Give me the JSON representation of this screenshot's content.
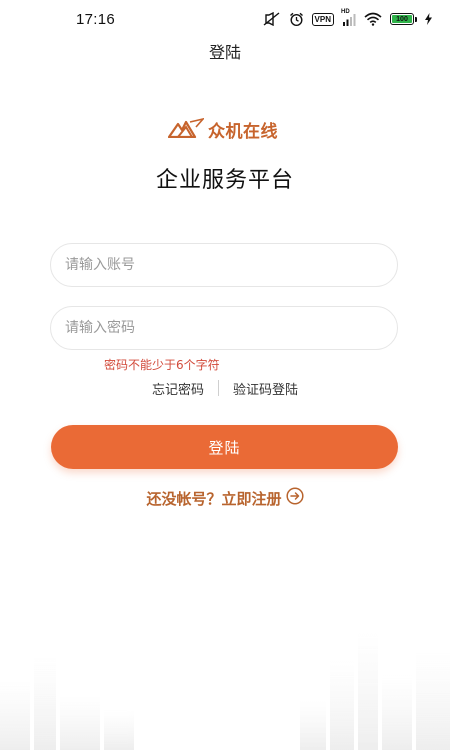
{
  "status_bar": {
    "time": "17:16",
    "vpn_label": "VPN",
    "network_label": "HD",
    "battery_level": "100",
    "colors": {
      "battery": "#2fb34a"
    }
  },
  "header": {
    "title": "登陆"
  },
  "brand": {
    "logo_text": "众机在线",
    "platform_title": "企业服务平台",
    "logo_color": "#c7642d"
  },
  "form": {
    "account_placeholder": "请输入账号",
    "password_placeholder": "请输入密码",
    "password_error": "密码不能少于6个字符",
    "forgot_password_label": "忘记密码",
    "sms_login_label": "验证码登陆",
    "login_button_label": "登陆",
    "register_label": "还没帐号？立即注册"
  },
  "colors": {
    "accent": "#ea6a36",
    "error": "#d24a3a",
    "link": "#b8642e"
  }
}
